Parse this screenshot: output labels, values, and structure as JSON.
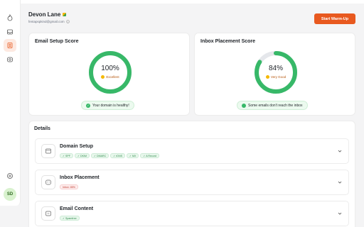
{
  "user": {
    "name": "Devon Lane",
    "email": "fentapspkind@gmail.com"
  },
  "header": {
    "cta_label": "Start Warm-Up"
  },
  "sidebar": {
    "icons": [
      "flame-icon",
      "inbox-icon",
      "contacts-icon",
      "mailbox-icon"
    ],
    "active_index": 2,
    "bottom_icon": "help-icon",
    "avatar_initials": "SD"
  },
  "cards": {
    "email_setup": {
      "title": "Email Setup Score",
      "score": "100%",
      "score_fraction": 1.0,
      "rating": "Excellent",
      "status": "Your domain is healthy!"
    },
    "inbox_placement": {
      "title": "Inbox Placement Score",
      "score": "84%",
      "score_fraction": 0.84,
      "rating": "Very Good",
      "status": "Some emails don't reach the inbox"
    }
  },
  "details": {
    "title": "Details",
    "rows": [
      {
        "title": "Domain Setup",
        "tags": [
          {
            "label": "SPF",
            "state": "ok"
          },
          {
            "label": "DKIM",
            "state": "ok"
          },
          {
            "label": "DMARC",
            "state": "ok"
          },
          {
            "label": "rDNS",
            "state": "ok"
          },
          {
            "label": "MX",
            "state": "ok"
          },
          {
            "label": "A Record",
            "state": "ok"
          }
        ]
      },
      {
        "title": "Inbox Placement",
        "tags": [
          {
            "label": "Inbox: 85%",
            "state": "bad"
          }
        ]
      },
      {
        "title": "Email Content",
        "tags": [
          {
            "label": "Spamfree",
            "state": "ok"
          }
        ]
      }
    ]
  },
  "colors": {
    "accent": "#e8591f",
    "success": "#37b868",
    "track": "#e5e7eb"
  }
}
